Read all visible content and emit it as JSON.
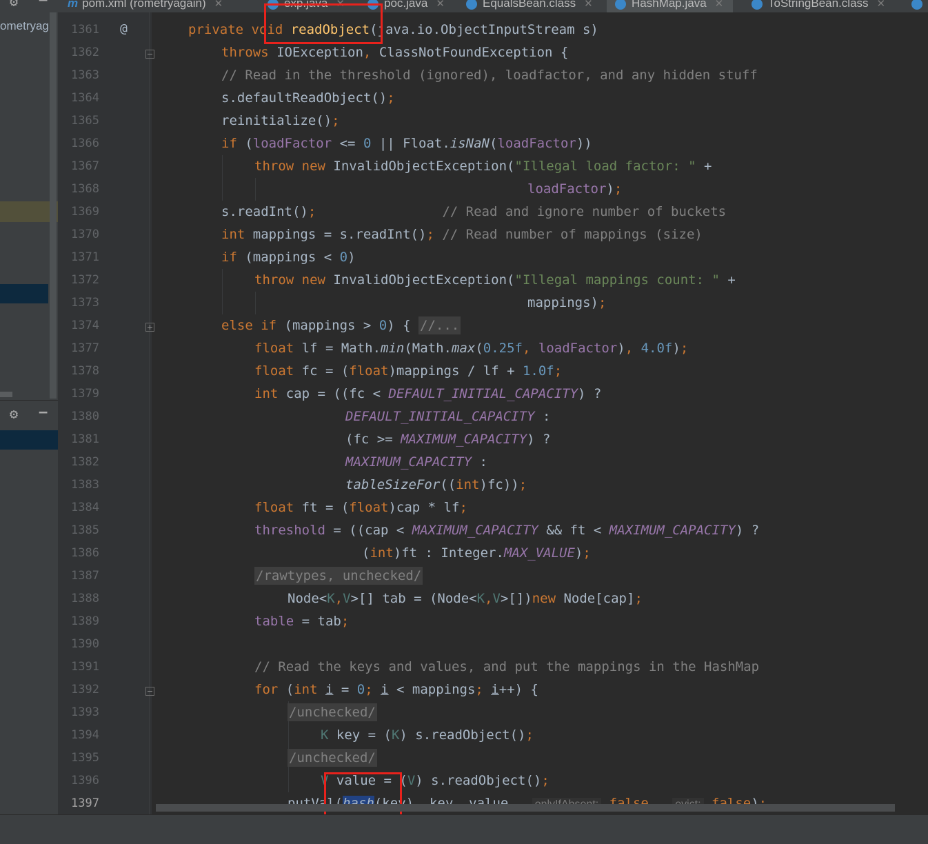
{
  "tabs": [
    {
      "label": "pom.xml (rometryagain)",
      "icon": "maven-icon"
    },
    {
      "label": "exp.java",
      "icon": "java-class-icon"
    },
    {
      "label": "poc.java",
      "icon": "java-class-icon"
    },
    {
      "label": "EqualsBean.class",
      "icon": "class-file-icon"
    },
    {
      "label": "HashMap.java",
      "icon": "class-file-icon",
      "active": true
    },
    {
      "label": "ToStringBean.class",
      "icon": "class-file-icon"
    }
  ],
  "project_panel": {
    "label": "ometryag"
  },
  "gutter": {
    "annotation": "@"
  },
  "lines": [
    {
      "no": "1361"
    },
    {
      "no": "1362"
    },
    {
      "no": "1363"
    },
    {
      "no": "1364"
    },
    {
      "no": "1365"
    },
    {
      "no": "1366"
    },
    {
      "no": "1367"
    },
    {
      "no": "1368"
    },
    {
      "no": "1369"
    },
    {
      "no": "1370"
    },
    {
      "no": "1371"
    },
    {
      "no": "1372"
    },
    {
      "no": "1373"
    },
    {
      "no": "1374"
    },
    {
      "no": "1377"
    },
    {
      "no": "1378"
    },
    {
      "no": "1379"
    },
    {
      "no": "1380"
    },
    {
      "no": "1381"
    },
    {
      "no": "1382"
    },
    {
      "no": "1383"
    },
    {
      "no": "1384"
    },
    {
      "no": "1385"
    },
    {
      "no": "1386"
    },
    {
      "no": "1387"
    },
    {
      "no": "1388"
    },
    {
      "no": "1389"
    },
    {
      "no": "1390"
    },
    {
      "no": "1391"
    },
    {
      "no": "1392"
    },
    {
      "no": "1393"
    },
    {
      "no": "1394"
    },
    {
      "no": "1395"
    },
    {
      "no": "1396"
    },
    {
      "no": "1397"
    }
  ],
  "code": {
    "l1361": {
      "a": "private void ",
      "b": "readObject",
      "c": "(java.io.ObjectInputStream s)"
    },
    "l1362": {
      "a": "throws ",
      "b": "IOException",
      "c": ", ",
      "d": "ClassNotFoundException {"
    },
    "l1363": {
      "a": "// Read in the threshold (ignored), loadfactor, and any hidden stuff"
    },
    "l1364": {
      "a": "s.defaultReadObject()",
      "b": ";"
    },
    "l1365": {
      "a": "reinitialize()",
      "b": ";"
    },
    "l1366": {
      "a": "if ",
      "b": "(",
      "c": "loadFactor",
      "d": " <= ",
      "e": "0",
      "f": " || Float.",
      "g": "isNaN",
      "h": "(",
      "i": "loadFactor",
      "j": "))"
    },
    "l1367": {
      "a": "throw new ",
      "b": "InvalidObjectException(",
      "c": "\"Illegal load factor: \"",
      "d": " +"
    },
    "l1368": {
      "a": "loadFactor",
      "b": ")",
      "c": ";"
    },
    "l1369": {
      "a": "s.readInt()",
      "b": ";",
      "c": "                // Read and ignore number of buckets"
    },
    "l1370": {
      "a": "int ",
      "b": "mappings = s.readInt()",
      "c": ";",
      "d": " // Read number of mappings (size)"
    },
    "l1371": {
      "a": "if ",
      "b": "(mappings < ",
      "c": "0",
      "d": ")"
    },
    "l1372": {
      "a": "throw new ",
      "b": "InvalidObjectException(",
      "c": "\"Illegal mappings count: \"",
      "d": " +"
    },
    "l1373": {
      "a": "mappings)",
      "b": ";"
    },
    "l1374": {
      "a": "else if ",
      "b": "(mappings > ",
      "c": "0",
      "d": ") { ",
      "e": "//..."
    },
    "l1377": {
      "a": "float ",
      "b": "lf = Math.",
      "c": "min",
      "d": "(Math.",
      "e": "max",
      "f": "(",
      "g": "0.25f",
      "h": ", ",
      "i": "loadFactor",
      "j": ")",
      "k": ", ",
      "l": "4.0f",
      "m": ")",
      "n": ";"
    },
    "l1378": {
      "a": "float ",
      "b": "fc = (",
      "c": "float",
      "d": ")mappings / lf + ",
      "e": "1.0f",
      "f": ";"
    },
    "l1379": {
      "a": "int ",
      "b": "cap = ((fc < ",
      "c": "DEFAULT_INITIAL_CAPACITY",
      "d": ") ?"
    },
    "l1380": {
      "a": "DEFAULT_INITIAL_CAPACITY",
      "b": " :"
    },
    "l1381": {
      "a": "(fc >= ",
      "b": "MAXIMUM_CAPACITY",
      "c": ") ?"
    },
    "l1382": {
      "a": "MAXIMUM_CAPACITY",
      "b": " :"
    },
    "l1383": {
      "a": "tableSizeFor",
      "b": "((",
      "c": "int",
      "d": ")fc))",
      "e": ";"
    },
    "l1384": {
      "a": "float ",
      "b": "ft = (",
      "c": "float",
      "d": ")cap * lf",
      "e": ";"
    },
    "l1385": {
      "a": "threshold",
      "b": " = ((cap < ",
      "c": "MAXIMUM_CAPACITY",
      "d": " && ft < ",
      "e": "MAXIMUM_CAPACITY",
      "f": ") ?"
    },
    "l1386": {
      "a": "(",
      "b": "int",
      "c": ")ft : Integer.",
      "d": "MAX_VALUE",
      "e": ")",
      "f": ";"
    },
    "l1387": {
      "a": "/rawtypes, unchecked/"
    },
    "l1388": {
      "a": "Node<",
      "b": "K",
      "c": ",",
      "d": "V",
      "e": ">[] tab = (Node<",
      "f": "K",
      "g": ",",
      "h": "V",
      "i": ">[])",
      "j": "new ",
      "k": "Node[cap]",
      "l": ";"
    },
    "l1389": {
      "a": "table",
      "b": " = tab",
      "c": ";"
    },
    "l1391": {
      "a": "// Read the keys and values, and put the mappings in the HashMap"
    },
    "l1392": {
      "a": "for ",
      "b": "(",
      "c": "int ",
      "d": "i",
      "e": " = ",
      "f": "0",
      "g": "; ",
      "h": "i",
      "i": " < mappings",
      "j": "; ",
      "k": "i",
      "l": "++) {"
    },
    "l1393": {
      "a": "/unchecked/"
    },
    "l1394": {
      "a": "K",
      "b": " key = (",
      "c": "K",
      "d": ") s.readObject()",
      "e": ";"
    },
    "l1395": {
      "a": "/unchecked/"
    },
    "l1396": {
      "a": "V",
      "b": " value = (",
      "c": "V",
      "d": ") s.readObject()",
      "e": ";"
    },
    "l1397": {
      "a": "putVal(",
      "b": "hash",
      "c": "(key)",
      "d": ", ",
      "e": "key",
      "f": ", ",
      "g": "value",
      "h": ", ",
      "i": "onlyIfAbsent:",
      "j": "false",
      "k": ", ",
      "l": "evict:",
      "m": "false",
      "n": ")",
      "o": ";"
    }
  },
  "colors": {
    "background": "#2b2b2b",
    "keyword": "#cc7832",
    "string": "#6a8759",
    "number": "#6897bb",
    "comment": "#808080",
    "field": "#9876aa",
    "method_decl": "#ffc66d",
    "highlight_box": "#e8221c"
  }
}
